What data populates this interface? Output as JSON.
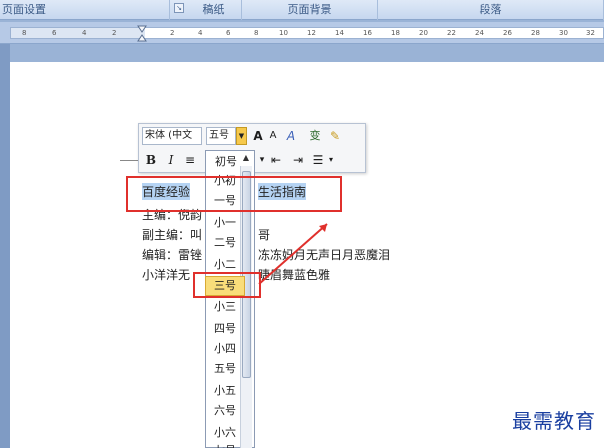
{
  "ribbon": {
    "groups": [
      "页面设置",
      "稿纸",
      "页面背景",
      "段落"
    ]
  },
  "ruler": {
    "ticks": [
      "8",
      "6",
      "4",
      "2",
      "2",
      "4",
      "6",
      "8",
      "10",
      "12",
      "14",
      "16",
      "18",
      "20",
      "22",
      "24",
      "26",
      "28",
      "30",
      "32"
    ]
  },
  "mini_toolbar": {
    "font": "宋体 (中文",
    "size": "五号",
    "grow_font": "A",
    "shrink_font": "A",
    "font_color": "A",
    "bold": "B",
    "italic": "I",
    "center": "≡",
    "highlight_lines": "▾",
    "decrease_indent": "⇤",
    "increase_indent": "⇥",
    "bullets": "☰"
  },
  "document": {
    "line1_selected_left": "百度经验",
    "line1_selected_right": "生活指南",
    "line2": "主编：倪韵",
    "line3_left": "副主编：叫",
    "line3_right": "哥",
    "line4_left": "编辑：雷锉",
    "line4_right": "冻冻妈月无声日月恶魔泪",
    "line5_left": "小洋洋无",
    "line5_right": "睫眉舞蓝色雅"
  },
  "size_list": {
    "items": [
      "初号",
      "小初",
      "一号",
      "小一",
      "二号",
      "小二",
      "三号",
      "小三",
      "四号",
      "小四",
      "五号",
      "小五",
      "六号",
      "小六",
      "七号"
    ],
    "highlighted": "三号"
  },
  "watermark": "最需教育"
}
